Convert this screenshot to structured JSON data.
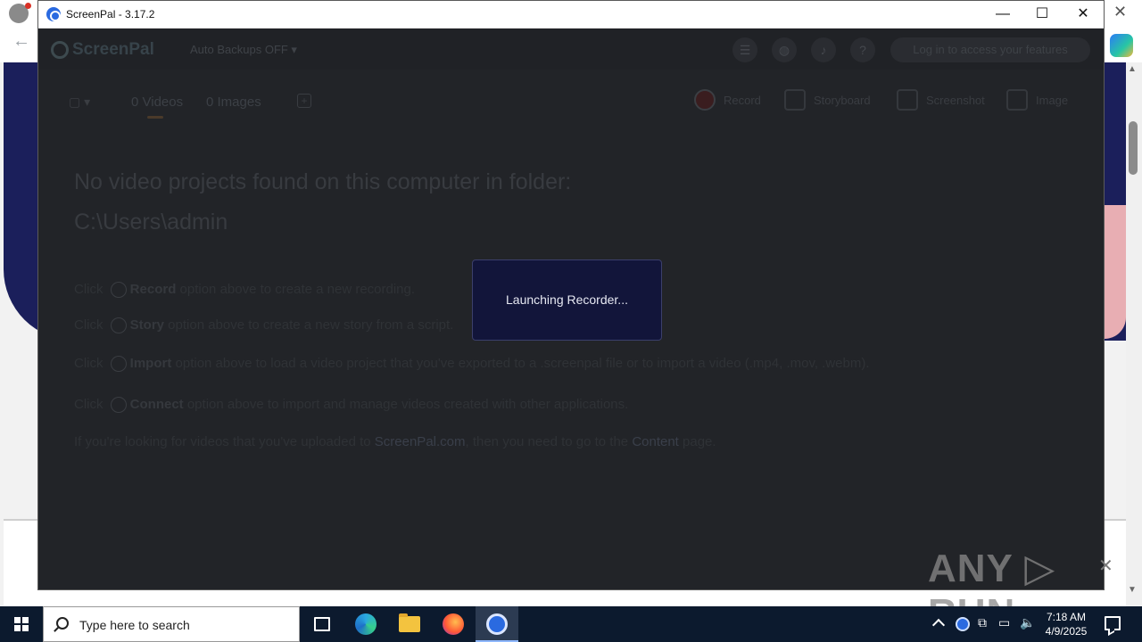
{
  "window": {
    "title": "ScreenPal - 3.17.2",
    "minimize_glyph": "—",
    "maximize_glyph": "☐",
    "close_glyph": "✕"
  },
  "header": {
    "logo_text": "ScreenPal",
    "backups_label": "Auto Backups OFF ▾",
    "menu_icon": "☰",
    "globe_icon": "◍",
    "mic_icon": "♪",
    "help_icon": "?",
    "login_label": "Log in to access your features"
  },
  "toolbar": {
    "folder_label": "▢ ▾",
    "tabs": [
      "0 Videos",
      "0 Images"
    ],
    "plus_label": "+",
    "tools": [
      "Record",
      "Storyboard",
      "Screenshot",
      "Image"
    ]
  },
  "content": {
    "empty_line1": "No video projects found on this computer in folder:",
    "empty_line2": "C:\\Users\\admin",
    "hints": [
      {
        "pre": "Click ",
        "bold": "Record",
        "post": " option above to create a new recording."
      },
      {
        "pre": "Click ",
        "bold": "Story",
        "post": " option above to create a new story from a script."
      },
      {
        "pre": "Click ",
        "bold": "Import",
        "post": " option above to load a video project that you've exported to a .screenpal file or to import a video (.mp4, .mov, .webm)."
      },
      {
        "pre": "Click ",
        "bold": "Connect",
        "post": " option above to import and manage videos created with other applications."
      }
    ],
    "footer_pre": "If you're looking for videos that you've uploaded to ",
    "footer_link1": "ScreenPal.com",
    "footer_mid": ", then you need to go to the ",
    "footer_link2": "Content",
    "footer_post": " page."
  },
  "dialog": {
    "message": "Launching Recorder..."
  },
  "watermark": {
    "text": "ANY ▷ RUN"
  },
  "taskbar": {
    "search_placeholder": "Type here to search",
    "time": "7:18 AM",
    "date": "4/9/2025"
  },
  "colors": {
    "app_bg": "#222428",
    "dialog_bg": "#12153a",
    "taskbar_bg": "#0c1a2e",
    "banner_bg": "#1b1f5b"
  }
}
